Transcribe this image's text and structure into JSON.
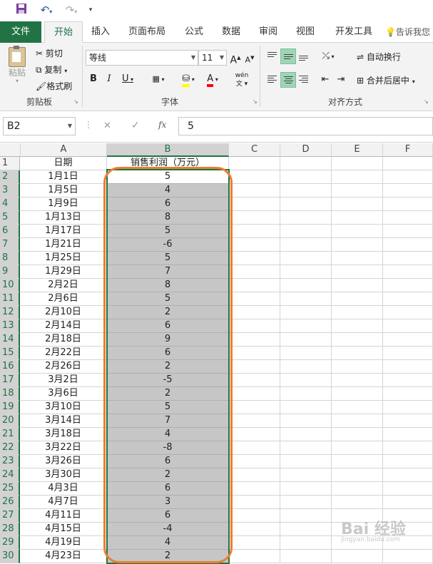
{
  "qat": {
    "save_icon": "save-icon",
    "undo_icon": "undo-icon",
    "redo_icon": "redo-icon",
    "customize_icon": "customize-qat-icon"
  },
  "tabs": [
    {
      "label": "文件",
      "file": true
    },
    {
      "label": "开始",
      "active": true
    },
    {
      "label": "插入"
    },
    {
      "label": "页面布局"
    },
    {
      "label": "公式"
    },
    {
      "label": "数据"
    },
    {
      "label": "审阅"
    },
    {
      "label": "视图"
    },
    {
      "label": "开发工具"
    },
    {
      "label": "告诉我您"
    }
  ],
  "ribbon": {
    "clipboard": {
      "paste": "粘贴",
      "cut": "剪切",
      "copy": "复制",
      "format_painter": "格式刷",
      "label": "剪贴板"
    },
    "font": {
      "font_name": "等线",
      "font_size": "11",
      "grow": "A",
      "shrink": "A",
      "bold": "B",
      "italic": "I",
      "underline": "U",
      "wen": "wén",
      "label": "字体"
    },
    "alignment": {
      "wrap": "自动换行",
      "merge": "合并后居中",
      "label": "对齐方式"
    }
  },
  "formula_bar": {
    "name_box": "B2",
    "cancel": "✕",
    "enter": "✓",
    "fx": "fx",
    "value": "5"
  },
  "columns": [
    "A",
    "B",
    "C",
    "D",
    "E",
    "F"
  ],
  "selected_column": "B",
  "header_row": {
    "A": "日期",
    "B": "销售利润（万元）"
  },
  "rows": [
    {
      "date": "1月1日",
      "profit": "5"
    },
    {
      "date": "1月5日",
      "profit": "4"
    },
    {
      "date": "1月9日",
      "profit": "6"
    },
    {
      "date": "1月13日",
      "profit": "8"
    },
    {
      "date": "1月17日",
      "profit": "5"
    },
    {
      "date": "1月21日",
      "profit": "-6"
    },
    {
      "date": "1月25日",
      "profit": "5"
    },
    {
      "date": "1月29日",
      "profit": "7"
    },
    {
      "date": "2月2日",
      "profit": "8"
    },
    {
      "date": "2月6日",
      "profit": "5"
    },
    {
      "date": "2月10日",
      "profit": "2"
    },
    {
      "date": "2月14日",
      "profit": "6"
    },
    {
      "date": "2月18日",
      "profit": "9"
    },
    {
      "date": "2月22日",
      "profit": "6"
    },
    {
      "date": "2月26日",
      "profit": "2"
    },
    {
      "date": "3月2日",
      "profit": "-5"
    },
    {
      "date": "3月6日",
      "profit": "2"
    },
    {
      "date": "3月10日",
      "profit": "5"
    },
    {
      "date": "3月14日",
      "profit": "7"
    },
    {
      "date": "3月18日",
      "profit": "4"
    },
    {
      "date": "3月22日",
      "profit": "-8"
    },
    {
      "date": "3月26日",
      "profit": "6"
    },
    {
      "date": "3月30日",
      "profit": "2"
    },
    {
      "date": "4月3日",
      "profit": "6"
    },
    {
      "date": "4月7日",
      "profit": "3"
    },
    {
      "date": "4月11日",
      "profit": "6"
    },
    {
      "date": "4月15日",
      "profit": "-4"
    },
    {
      "date": "4月19日",
      "profit": "4"
    },
    {
      "date": "4月23日",
      "profit": "2"
    }
  ],
  "watermark": {
    "main": "Bai 经验",
    "sub": "jingyan.baidu.com"
  },
  "colors": {
    "excel_green": "#217346",
    "selection_gray": "#c6c6c6",
    "highlight_orange": "#ed7d31"
  }
}
